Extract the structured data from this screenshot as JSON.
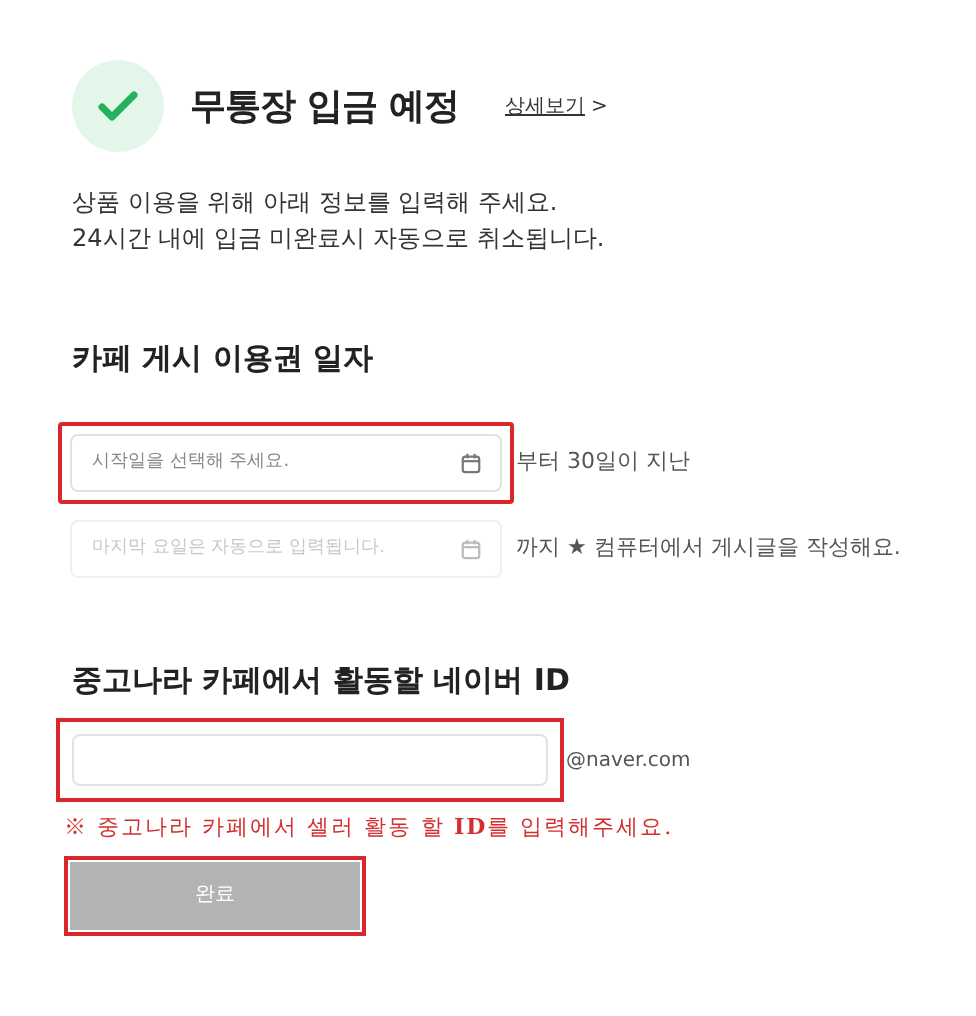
{
  "header": {
    "title": "무통장 입금 예정",
    "detail_link": "상세보기",
    "detail_arrow": ">"
  },
  "intro": [
    "상품 이용을 위해 아래 정보를 입력해 주세요.",
    "24시간 내에 입금 미완료시 자동으로 취소됩니다."
  ],
  "date_section": {
    "heading": "카페 게시 이용권 일자",
    "fields": [
      {
        "placeholder": "시작일을 선택해 주세요.",
        "disabled": false,
        "highlighted": true,
        "suffix": "부터 30일이 지난"
      },
      {
        "placeholder": "마지막 요일은 자동으로 입력됩니다.",
        "disabled": true,
        "highlighted": false,
        "suffix": "까지 ★ 컴퓨터에서 게시글을 작성해요."
      }
    ]
  },
  "id_section": {
    "heading": "중고나라 카페에서 활동할 네이버 ID",
    "highlighted": true,
    "domain": "@naver.com",
    "note": "※ 중고나라 카페에서 셀러 활동 할 **ID**를 입력해주세요."
  },
  "submit": {
    "label": "완료",
    "disabled": true,
    "highlighted": true
  }
}
